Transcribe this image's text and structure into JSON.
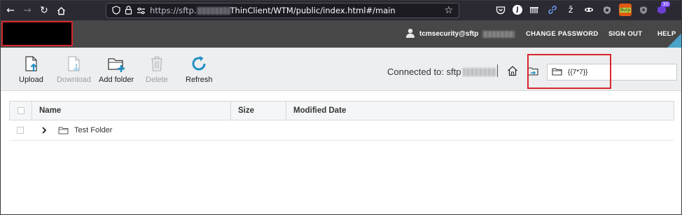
{
  "browser": {
    "url_prefix": "https://sftp.",
    "url_suffix": "ThinClient/WTM/public/index.html#/main",
    "icons": [
      "back-icon",
      "forward-icon",
      "reload-icon",
      "home-icon",
      "shield-icon",
      "lock-icon",
      "permissions-icon",
      "star-icon"
    ],
    "extensions": [
      "pocket-icon",
      "ext-j-icon",
      "ext-bars-icon",
      "link-icon",
      "ext-script-icon",
      "ext-spy-icon",
      "ublock-icon",
      "burp-icon",
      "shield-ext-icon",
      "ext-badge-icon"
    ],
    "burp_label": "Burp",
    "badge_count": "30"
  },
  "header": {
    "user": "tcmsecurity@sftp",
    "links": {
      "change_password": "CHANGE PASSWORD",
      "sign_out": "SIGN OUT",
      "help": "HELP"
    }
  },
  "toolbar": {
    "upload": "Upload",
    "download": "Download",
    "add_folder": "Add folder",
    "delete": "Delete",
    "refresh": "Refresh",
    "connected_to": "Connected to: sftp",
    "path_value": "{{7*7}}"
  },
  "table": {
    "columns": [
      "Name",
      "Size",
      "Modified Date"
    ],
    "rows": [
      {
        "name": "Test Folder",
        "size": "",
        "modified": ""
      }
    ]
  },
  "colors": {
    "header_bg": "#474747",
    "toolbar_bg": "#eceeef",
    "accent": "#1f8fc3",
    "highlight": "#d8262c"
  }
}
